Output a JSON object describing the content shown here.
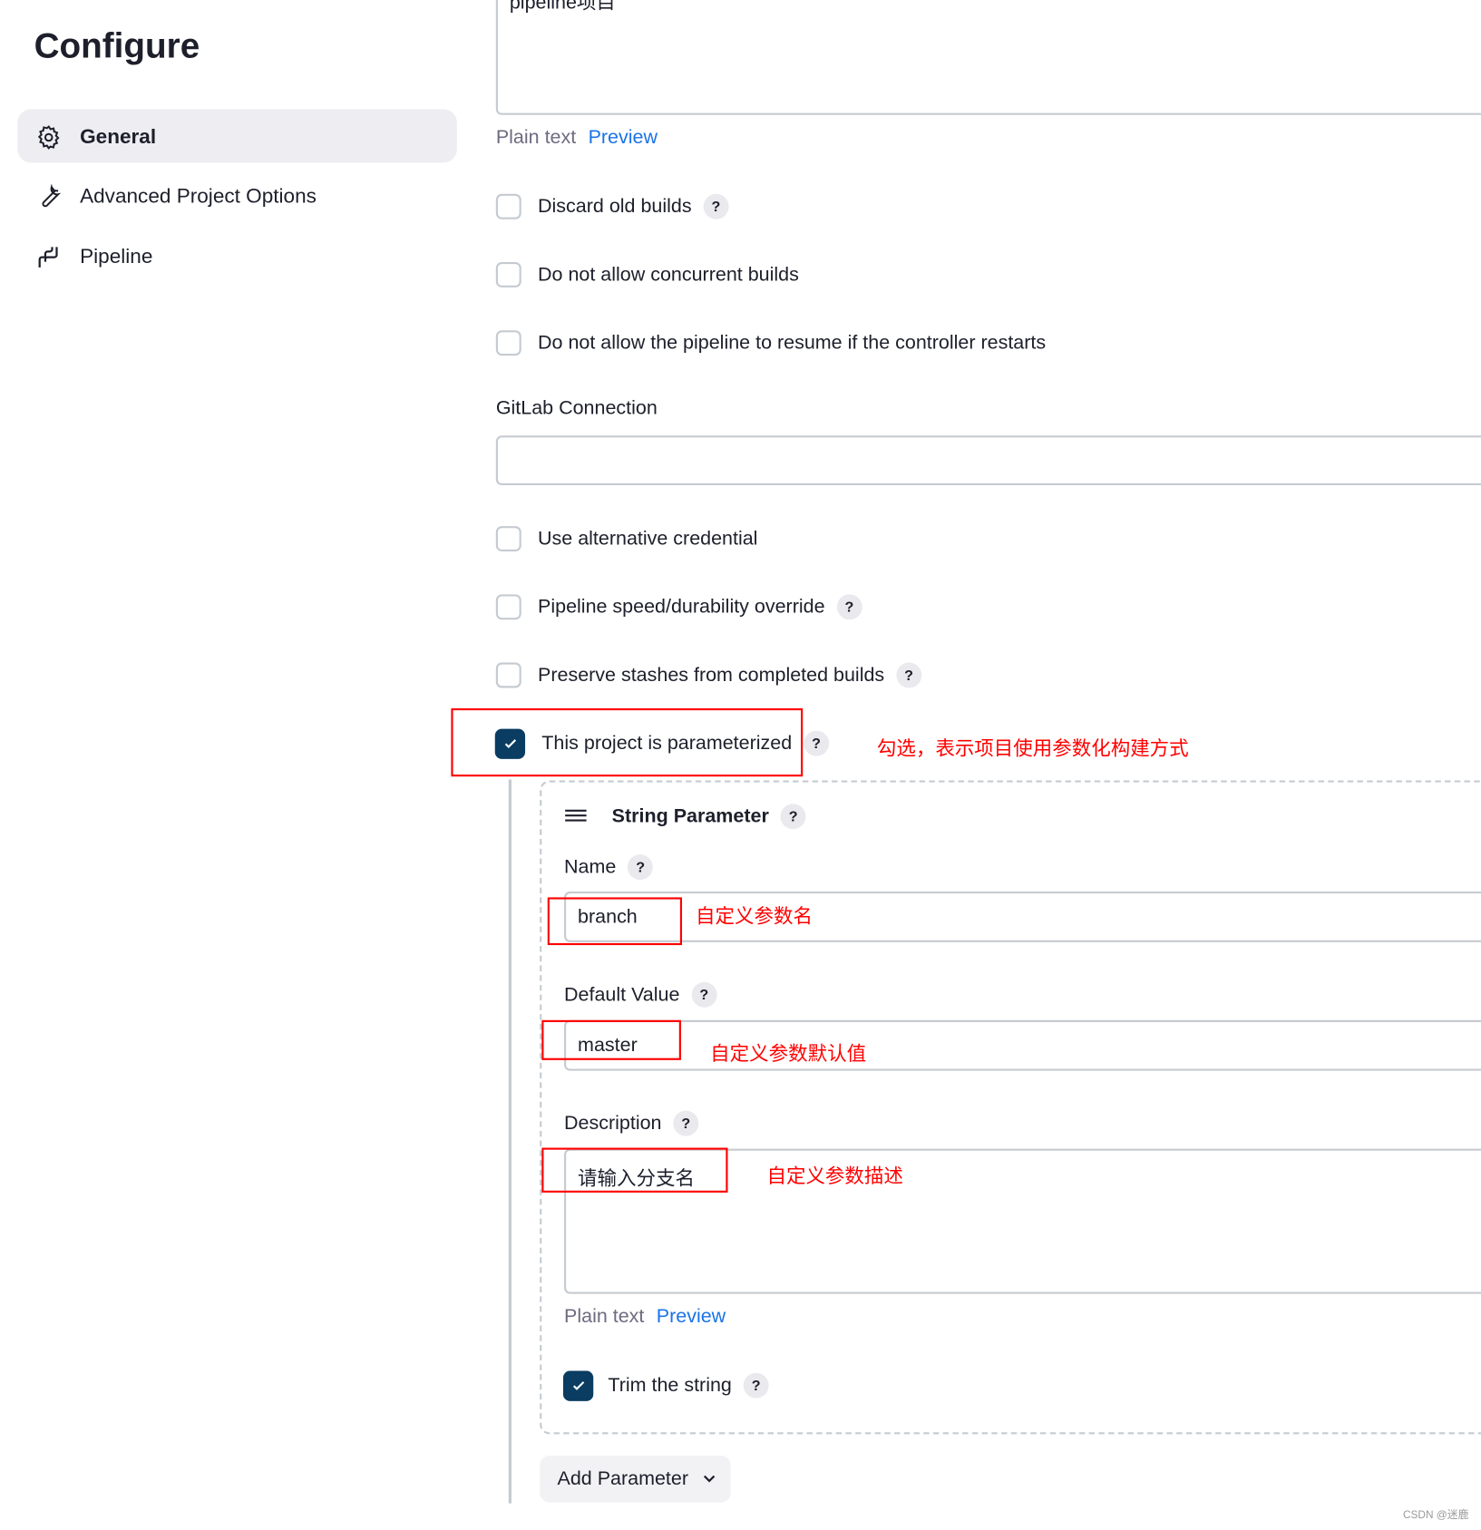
{
  "sidebar": {
    "title": "Configure",
    "items": [
      {
        "label": "General",
        "icon": "gear-icon",
        "active": true
      },
      {
        "label": "Advanced Project Options",
        "icon": "wrench-icon"
      },
      {
        "label": "Pipeline",
        "icon": "pipeline-icon"
      }
    ]
  },
  "description": {
    "value": "pipeline项目",
    "plain_text": "Plain text",
    "preview": "Preview"
  },
  "options": [
    {
      "label": "Discard old builds",
      "checked": false,
      "help": true
    },
    {
      "label": "Do not allow concurrent builds",
      "checked": false,
      "help": false
    },
    {
      "label": "Do not allow the pipeline to resume if the controller restarts",
      "checked": false,
      "help": false
    }
  ],
  "gitlab": {
    "label": "GitLab Connection",
    "value": ""
  },
  "options2": [
    {
      "label": "Use alternative credential",
      "checked": false,
      "help": false
    },
    {
      "label": "Pipeline speed/durability override",
      "checked": false,
      "help": true
    },
    {
      "label": "Preserve stashes from completed builds",
      "checked": false,
      "help": true
    },
    {
      "label": "This project is parameterized",
      "checked": true,
      "help": true
    }
  ],
  "help_glyph": "?",
  "string_param": {
    "title": "String Parameter",
    "name_label": "Name",
    "name_value": "branch",
    "default_label": "Default Value",
    "default_value": "master",
    "desc_label": "Description",
    "desc_value": "请输入分支名",
    "plain_text": "Plain text",
    "preview": "Preview",
    "trim_label": "Trim the string",
    "trim_checked": true
  },
  "add_parameter": "Add Parameter",
  "annotations": {
    "parameterized": "勾选，表示项目使用参数化构建方式",
    "name": "自定义参数名",
    "default": "自定义参数默认值",
    "description": "自定义参数描述"
  },
  "colors": {
    "accent": "#0b3d62",
    "link": "#1a73e8",
    "annotation": "#ff0000"
  },
  "watermark": "CSDN @迷鹿"
}
